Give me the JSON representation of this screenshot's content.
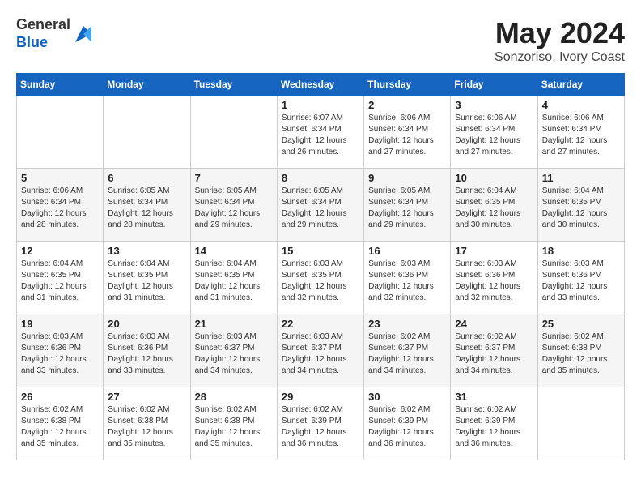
{
  "header": {
    "logo": {
      "general": "General",
      "blue": "Blue"
    },
    "title": "May 2024",
    "location": "Sonzoriso, Ivory Coast"
  },
  "days_of_week": [
    "Sunday",
    "Monday",
    "Tuesday",
    "Wednesday",
    "Thursday",
    "Friday",
    "Saturday"
  ],
  "weeks": [
    [
      {
        "day": "",
        "info": ""
      },
      {
        "day": "",
        "info": ""
      },
      {
        "day": "",
        "info": ""
      },
      {
        "day": "1",
        "sunrise": "6:07 AM",
        "sunset": "6:34 PM",
        "daylight": "12 hours and 26 minutes."
      },
      {
        "day": "2",
        "sunrise": "6:06 AM",
        "sunset": "6:34 PM",
        "daylight": "12 hours and 27 minutes."
      },
      {
        "day": "3",
        "sunrise": "6:06 AM",
        "sunset": "6:34 PM",
        "daylight": "12 hours and 27 minutes."
      },
      {
        "day": "4",
        "sunrise": "6:06 AM",
        "sunset": "6:34 PM",
        "daylight": "12 hours and 27 minutes."
      }
    ],
    [
      {
        "day": "5",
        "sunrise": "6:06 AM",
        "sunset": "6:34 PM",
        "daylight": "12 hours and 28 minutes."
      },
      {
        "day": "6",
        "sunrise": "6:05 AM",
        "sunset": "6:34 PM",
        "daylight": "12 hours and 28 minutes."
      },
      {
        "day": "7",
        "sunrise": "6:05 AM",
        "sunset": "6:34 PM",
        "daylight": "12 hours and 29 minutes."
      },
      {
        "day": "8",
        "sunrise": "6:05 AM",
        "sunset": "6:34 PM",
        "daylight": "12 hours and 29 minutes."
      },
      {
        "day": "9",
        "sunrise": "6:05 AM",
        "sunset": "6:34 PM",
        "daylight": "12 hours and 29 minutes."
      },
      {
        "day": "10",
        "sunrise": "6:04 AM",
        "sunset": "6:35 PM",
        "daylight": "12 hours and 30 minutes."
      },
      {
        "day": "11",
        "sunrise": "6:04 AM",
        "sunset": "6:35 PM",
        "daylight": "12 hours and 30 minutes."
      }
    ],
    [
      {
        "day": "12",
        "sunrise": "6:04 AM",
        "sunset": "6:35 PM",
        "daylight": "12 hours and 31 minutes."
      },
      {
        "day": "13",
        "sunrise": "6:04 AM",
        "sunset": "6:35 PM",
        "daylight": "12 hours and 31 minutes."
      },
      {
        "day": "14",
        "sunrise": "6:04 AM",
        "sunset": "6:35 PM",
        "daylight": "12 hours and 31 minutes."
      },
      {
        "day": "15",
        "sunrise": "6:03 AM",
        "sunset": "6:35 PM",
        "daylight": "12 hours and 32 minutes."
      },
      {
        "day": "16",
        "sunrise": "6:03 AM",
        "sunset": "6:36 PM",
        "daylight": "12 hours and 32 minutes."
      },
      {
        "day": "17",
        "sunrise": "6:03 AM",
        "sunset": "6:36 PM",
        "daylight": "12 hours and 32 minutes."
      },
      {
        "day": "18",
        "sunrise": "6:03 AM",
        "sunset": "6:36 PM",
        "daylight": "12 hours and 33 minutes."
      }
    ],
    [
      {
        "day": "19",
        "sunrise": "6:03 AM",
        "sunset": "6:36 PM",
        "daylight": "12 hours and 33 minutes."
      },
      {
        "day": "20",
        "sunrise": "6:03 AM",
        "sunset": "6:36 PM",
        "daylight": "12 hours and 33 minutes."
      },
      {
        "day": "21",
        "sunrise": "6:03 AM",
        "sunset": "6:37 PM",
        "daylight": "12 hours and 34 minutes."
      },
      {
        "day": "22",
        "sunrise": "6:03 AM",
        "sunset": "6:37 PM",
        "daylight": "12 hours and 34 minutes."
      },
      {
        "day": "23",
        "sunrise": "6:02 AM",
        "sunset": "6:37 PM",
        "daylight": "12 hours and 34 minutes."
      },
      {
        "day": "24",
        "sunrise": "6:02 AM",
        "sunset": "6:37 PM",
        "daylight": "12 hours and 34 minutes."
      },
      {
        "day": "25",
        "sunrise": "6:02 AM",
        "sunset": "6:38 PM",
        "daylight": "12 hours and 35 minutes."
      }
    ],
    [
      {
        "day": "26",
        "sunrise": "6:02 AM",
        "sunset": "6:38 PM",
        "daylight": "12 hours and 35 minutes."
      },
      {
        "day": "27",
        "sunrise": "6:02 AM",
        "sunset": "6:38 PM",
        "daylight": "12 hours and 35 minutes."
      },
      {
        "day": "28",
        "sunrise": "6:02 AM",
        "sunset": "6:38 PM",
        "daylight": "12 hours and 35 minutes."
      },
      {
        "day": "29",
        "sunrise": "6:02 AM",
        "sunset": "6:39 PM",
        "daylight": "12 hours and 36 minutes."
      },
      {
        "day": "30",
        "sunrise": "6:02 AM",
        "sunset": "6:39 PM",
        "daylight": "12 hours and 36 minutes."
      },
      {
        "day": "31",
        "sunrise": "6:02 AM",
        "sunset": "6:39 PM",
        "daylight": "12 hours and 36 minutes."
      },
      {
        "day": "",
        "info": ""
      }
    ]
  ]
}
